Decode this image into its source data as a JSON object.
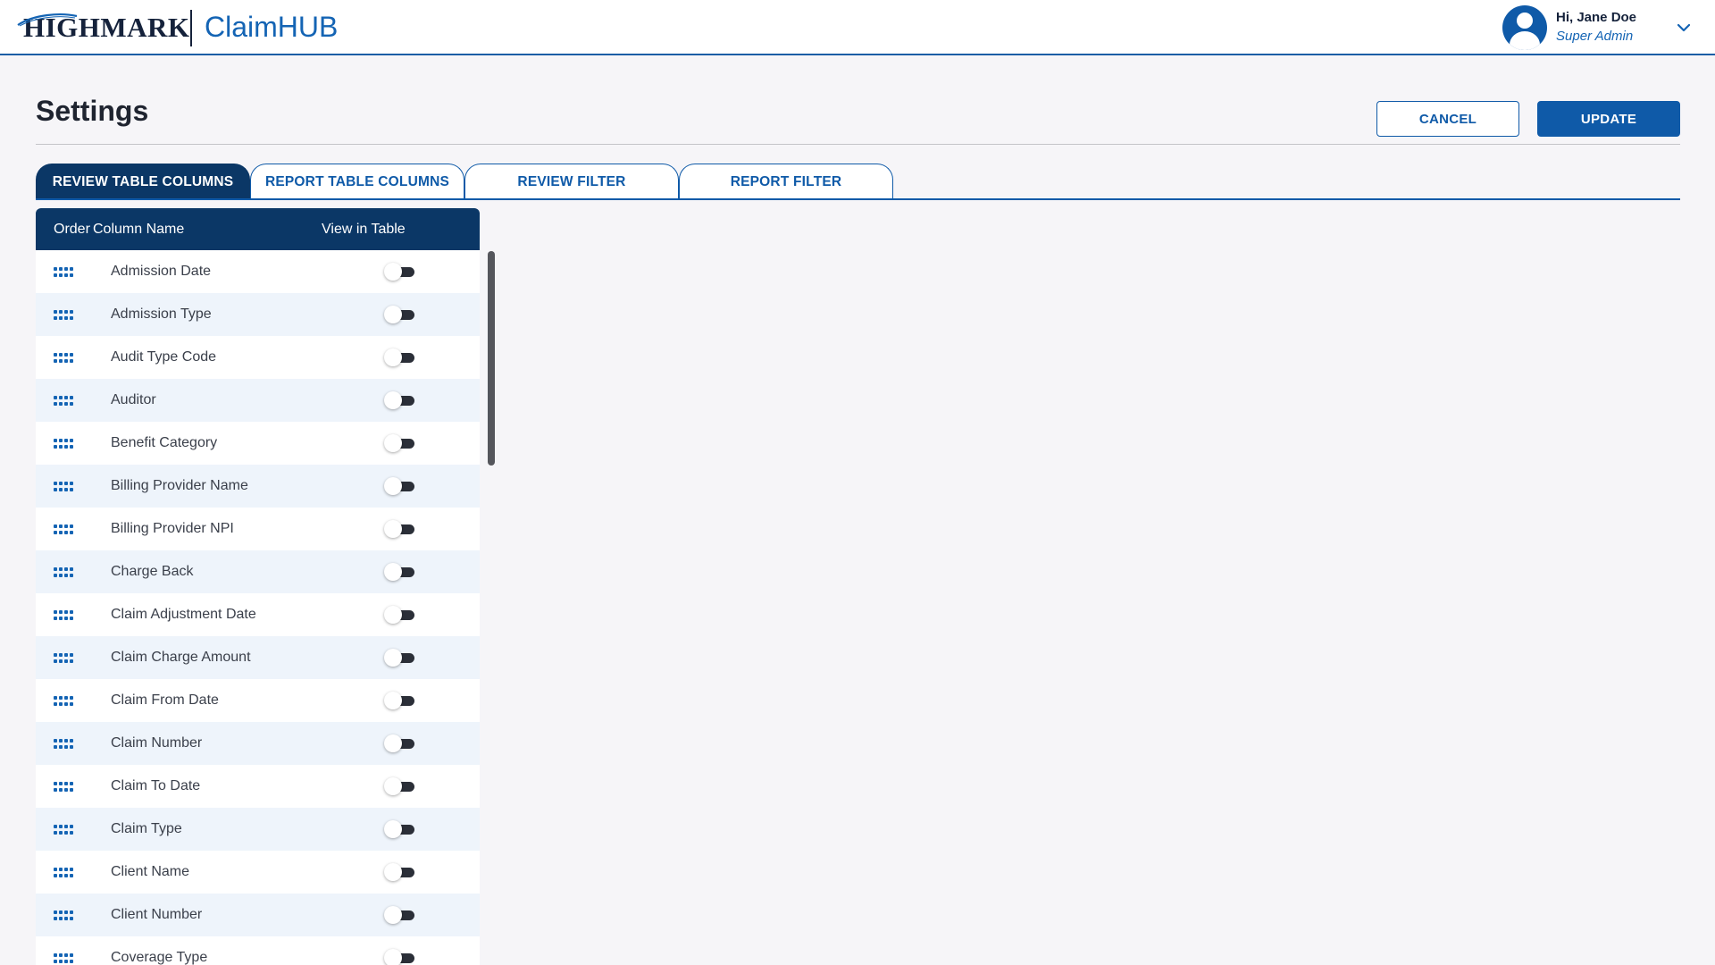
{
  "header": {
    "logo_text": "HIGHMARK",
    "app_name": "ClaimHUB",
    "user_greeting": "Hi, Jane Doe",
    "user_role": "Super Admin",
    "user_icon": "user-avatar-icon",
    "menu_icon": "chevron-down-icon"
  },
  "page": {
    "title": "Settings",
    "cancel_label": "CANCEL",
    "update_label": "UPDATE"
  },
  "tabs": [
    {
      "label": "REVIEW TABLE COLUMNS",
      "active": true
    },
    {
      "label": "REPORT TABLE COLUMNS",
      "active": false
    },
    {
      "label": "REVIEW FILTER",
      "active": false
    },
    {
      "label": "REPORT FILTER",
      "active": false
    }
  ],
  "table": {
    "headers": {
      "order": "Order",
      "name": "Column Name",
      "view": "View in Table"
    },
    "rows": [
      {
        "name": "Admission Date",
        "view": false
      },
      {
        "name": "Admission Type",
        "view": false
      },
      {
        "name": "Audit Type Code",
        "view": false
      },
      {
        "name": "Auditor",
        "view": false
      },
      {
        "name": "Benefit Category",
        "view": false
      },
      {
        "name": "Billing Provider Name",
        "view": false
      },
      {
        "name": "Billing Provider NPI",
        "view": false
      },
      {
        "name": "Charge Back",
        "view": false
      },
      {
        "name": "Claim Adjustment Date",
        "view": false
      },
      {
        "name": "Claim Charge Amount",
        "view": false
      },
      {
        "name": "Claim From Date",
        "view": false
      },
      {
        "name": "Claim Number",
        "view": false
      },
      {
        "name": "Claim To Date",
        "view": false
      },
      {
        "name": "Claim Type",
        "view": false
      },
      {
        "name": "Client Name",
        "view": false
      },
      {
        "name": "Client Number",
        "view": false
      },
      {
        "name": "Coverage Type",
        "view": false
      }
    ]
  },
  "colors": {
    "brand_blue": "#0f5aa8",
    "navy": "#0b3766",
    "row_alt": "#eef4fb",
    "background": "#f6f5f8"
  }
}
